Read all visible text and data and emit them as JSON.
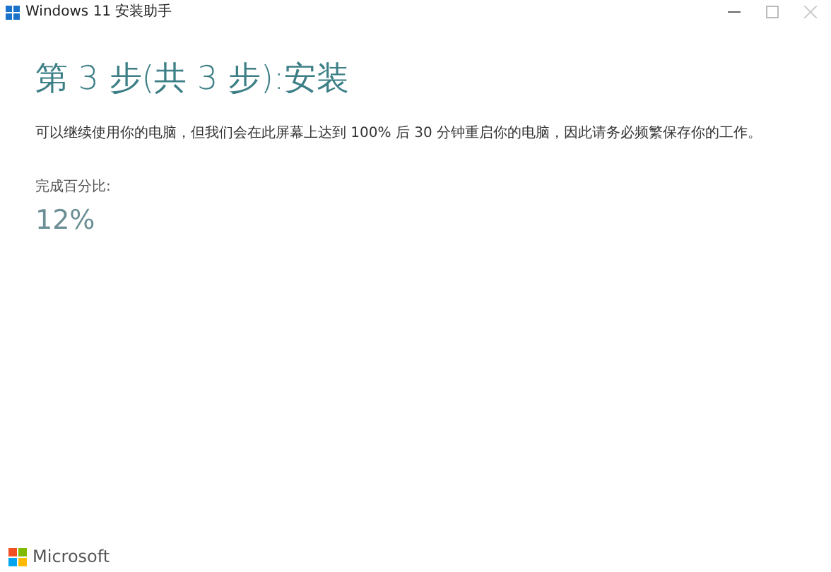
{
  "window": {
    "title": "Windows 11 安装助手"
  },
  "heading": "第 3 步(共 3 步):安装",
  "description": "可以继续使用你的电脑，但我们会在此屏幕上达到 100% 后 30 分钟重启你的电脑，因此请务必频繁保存你的工作。",
  "progress": {
    "label": "完成百分比:",
    "value": "12%"
  },
  "footer": {
    "brand": "Microsoft"
  }
}
